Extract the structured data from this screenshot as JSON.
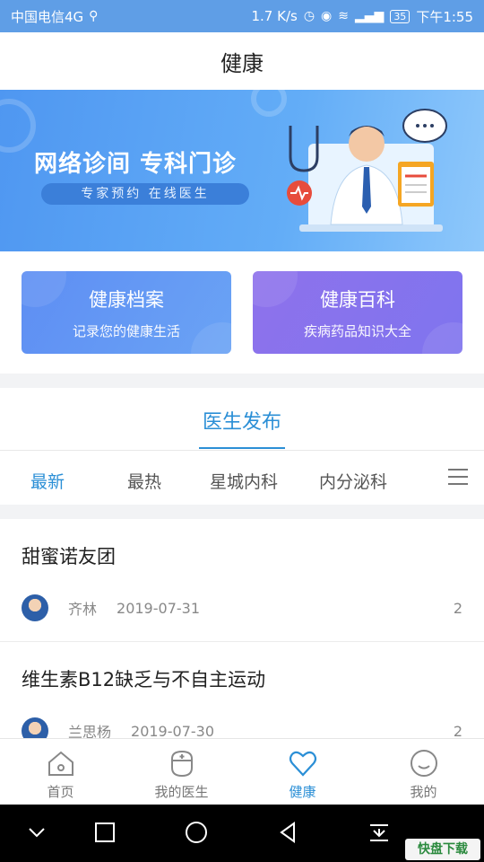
{
  "status_bar": {
    "carrier": "中国电信4G",
    "speed": "1.7 K/s",
    "battery": "35",
    "time": "下午1:55"
  },
  "header": {
    "title": "健康"
  },
  "banner": {
    "title": "网络诊间  专科门诊",
    "subtitle": "专家预约  在线医生"
  },
  "cards": [
    {
      "title": "健康档案",
      "subtitle": "记录您的健康生活",
      "color": "#5e8ef3"
    },
    {
      "title": "健康百科",
      "subtitle": "疾病药品知识大全",
      "color": "#8e72ec"
    }
  ],
  "section": {
    "title": "医生发布"
  },
  "tabs": [
    "最新",
    "最热",
    "星城内科",
    "内分泌科"
  ],
  "articles": [
    {
      "title": "甜蜜诺友团",
      "author": "齐林",
      "date": "2019-07-31",
      "count": "2"
    },
    {
      "title": "维生素B12缺乏与不自主运动",
      "author": "兰思杨",
      "date": "2019-07-30",
      "count": "2"
    }
  ],
  "bottom_nav": [
    {
      "label": "首页",
      "icon": "home-icon"
    },
    {
      "label": "我的医生",
      "icon": "doctor-icon"
    },
    {
      "label": "健康",
      "icon": "heart-icon"
    },
    {
      "label": "我的",
      "icon": "profile-icon"
    }
  ],
  "colors": {
    "accent": "#2b8fd6",
    "statusbar": "#5f9ee6"
  }
}
